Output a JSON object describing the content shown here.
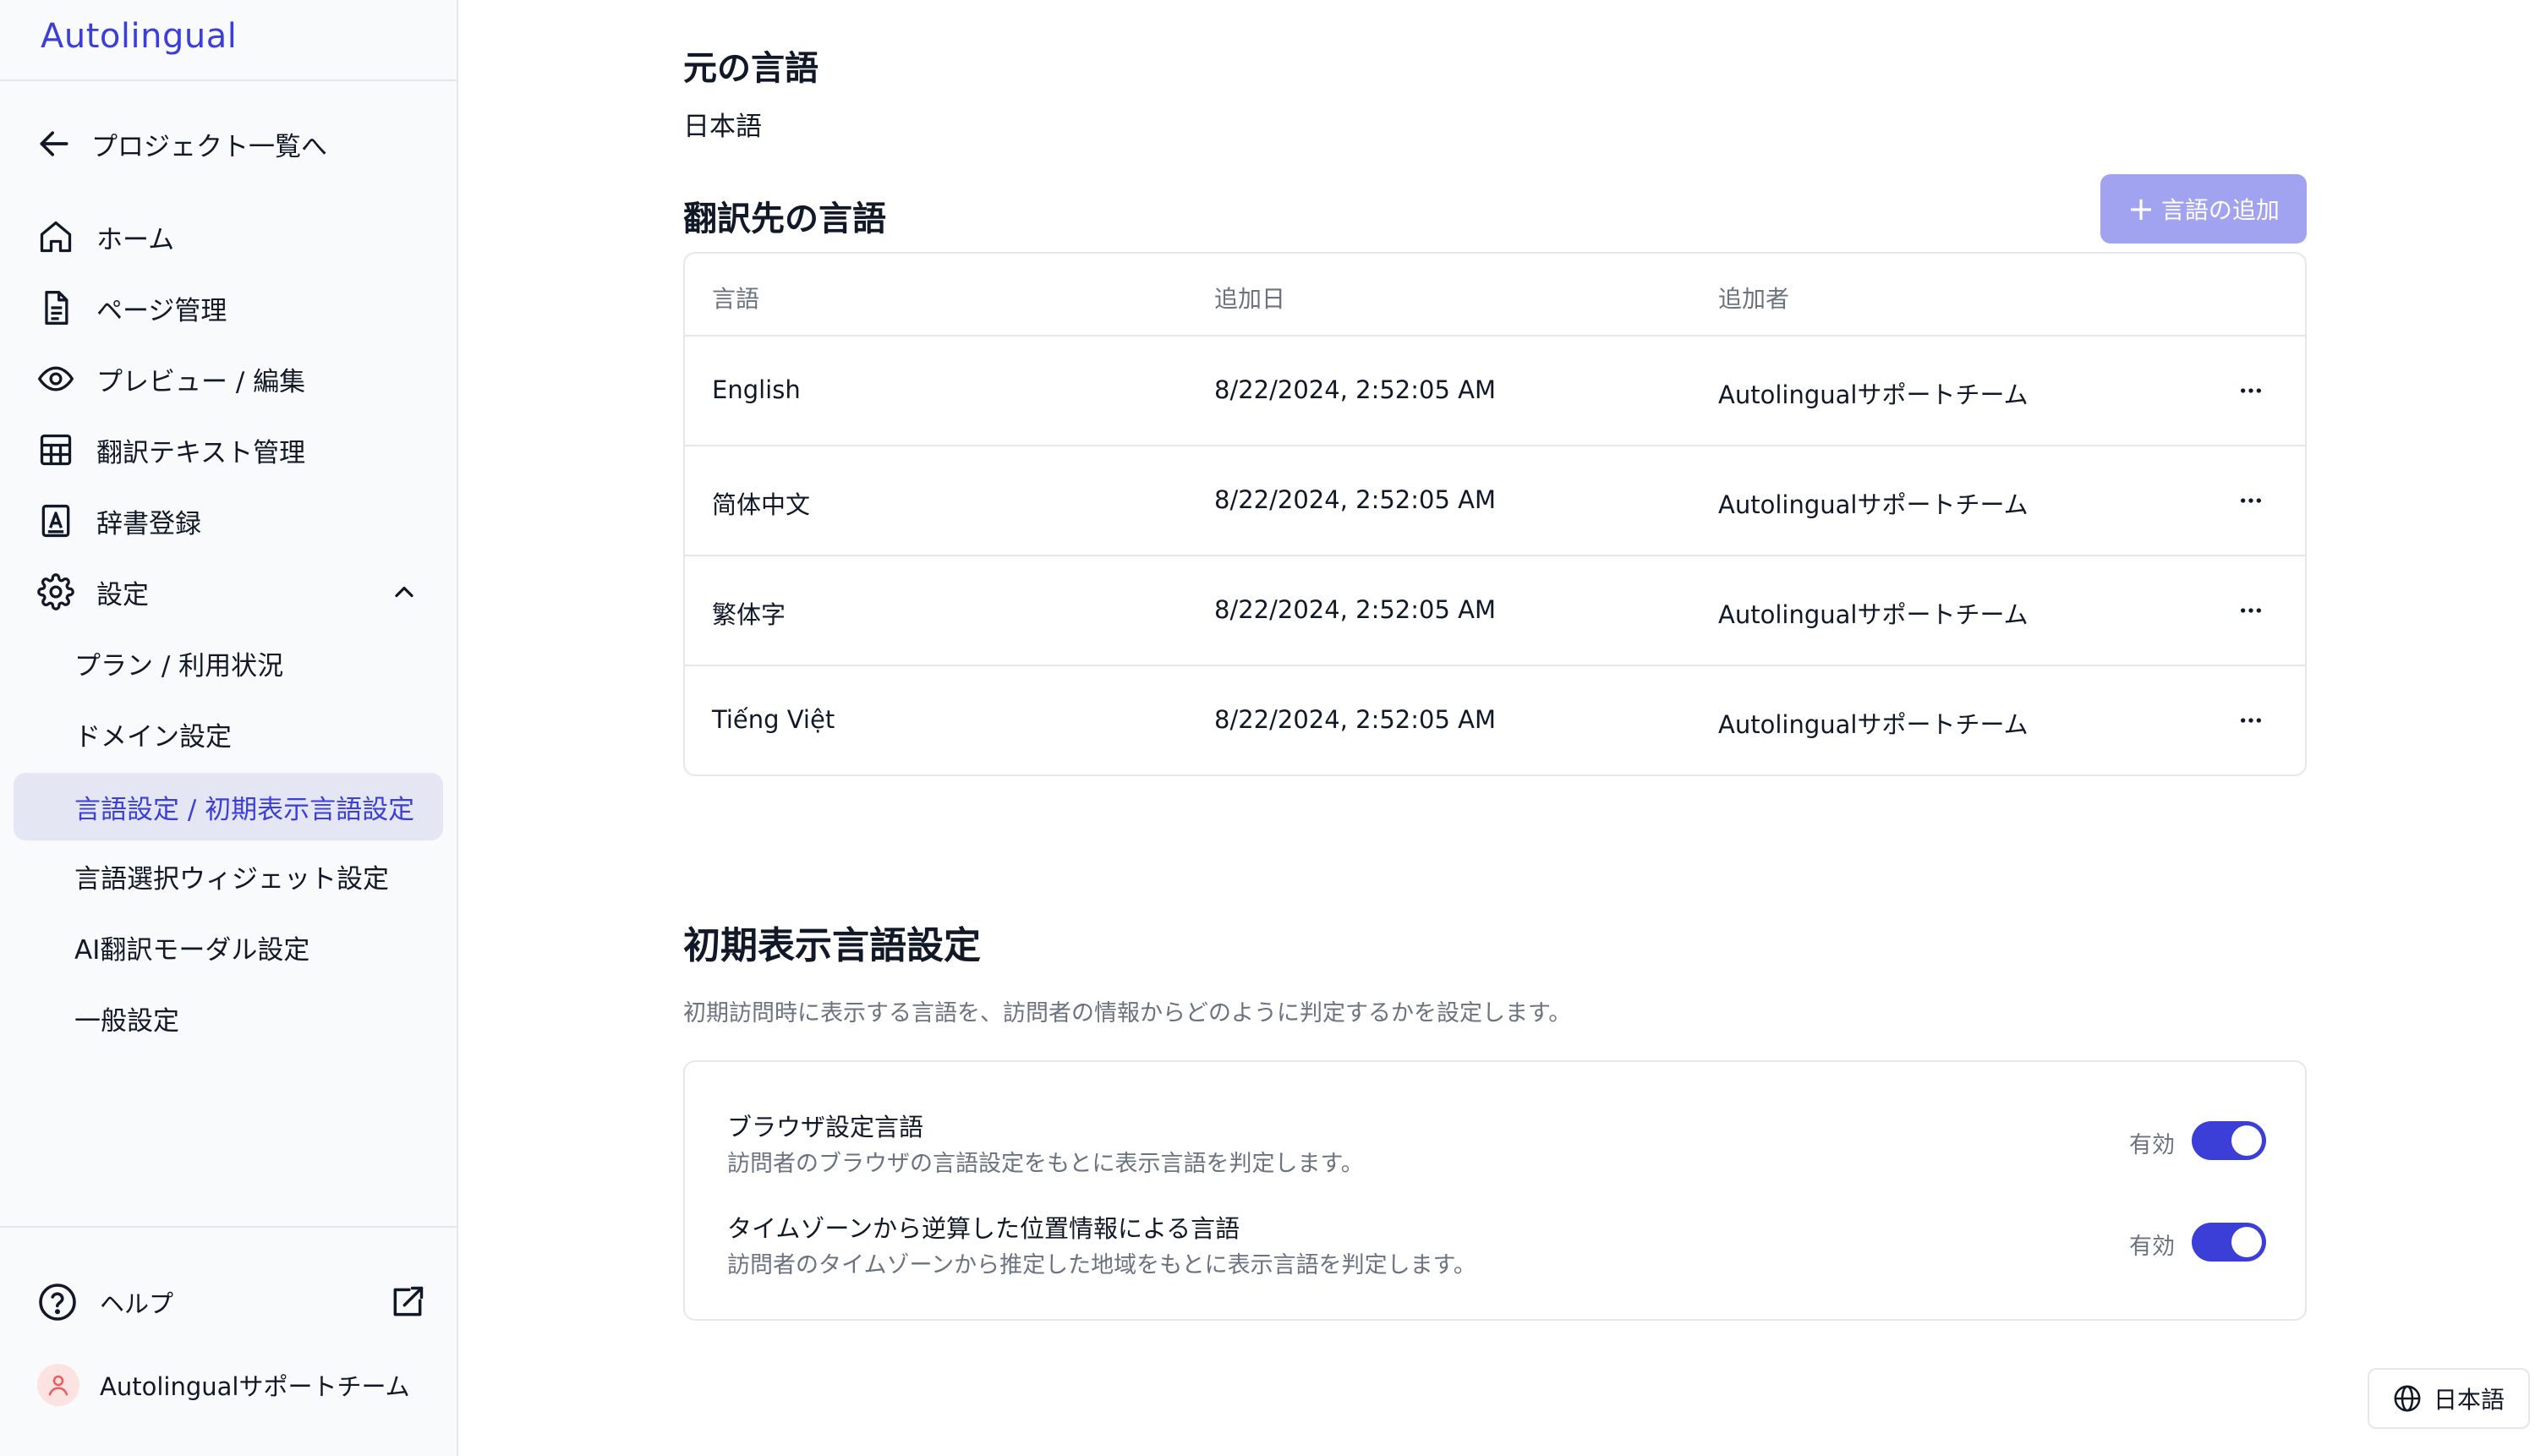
{
  "app": {
    "brand": "Autolingual"
  },
  "sidebar": {
    "back_label": "プロジェクト一覧へ",
    "items": [
      {
        "label": "ホーム",
        "icon": "home-icon"
      },
      {
        "label": "ページ管理",
        "icon": "document-icon"
      },
      {
        "label": "プレビュー / 編集",
        "icon": "eye-icon"
      },
      {
        "label": "翻訳テキスト管理",
        "icon": "table-icon"
      },
      {
        "label": "辞書登録",
        "icon": "dictionary-icon"
      },
      {
        "label": "設定",
        "icon": "gear-icon",
        "expanded": true
      }
    ],
    "sub_items": [
      {
        "label": "プラン / 利用状況"
      },
      {
        "label": "ドメイン設定"
      },
      {
        "label": "言語設定 / 初期表示言語設定",
        "active": true
      },
      {
        "label": "言語選択ウィジェット設定"
      },
      {
        "label": "AI翻訳モーダル設定"
      },
      {
        "label": "一般設定"
      }
    ],
    "help_label": "ヘルプ",
    "user_name": "Autolingualサポートチーム"
  },
  "source": {
    "heading": "元の言語",
    "value": "日本語"
  },
  "targets": {
    "heading": "翻訳先の言語",
    "add_button": "言語の追加",
    "columns": [
      "言語",
      "追加日",
      "追加者"
    ],
    "rows": [
      {
        "language": "English",
        "added_date": "8/22/2024, 2:52:05 AM",
        "added_by": "Autolingualサポートチーム"
      },
      {
        "language": "简体中文",
        "added_date": "8/22/2024, 2:52:05 AM",
        "added_by": "Autolingualサポートチーム"
      },
      {
        "language": "繁体字",
        "added_date": "8/22/2024, 2:52:05 AM",
        "added_by": "Autolingualサポートチーム"
      },
      {
        "language": "Tiếng Việt",
        "added_date": "8/22/2024, 2:52:05 AM",
        "added_by": "Autolingualサポートチーム"
      }
    ]
  },
  "initial_display": {
    "heading": "初期表示言語設定",
    "description": "初期訪問時に表示する言語を、訪問者の情報からどのように判定するかを設定します。",
    "options": [
      {
        "title": "ブラウザ設定言語",
        "description": "訪問者のブラウザの言語設定をもとに表示言語を判定します。",
        "toggle_label": "有効",
        "enabled": true
      },
      {
        "title": "タイムゾーンから逆算した位置情報による言語",
        "description": "訪問者のタイムゾーンから推定した地域をもとに表示言語を判定します。",
        "toggle_label": "有効",
        "enabled": true
      }
    ]
  },
  "language_switcher": {
    "label": "日本語",
    "icon": "globe-icon"
  },
  "colors": {
    "accent": "#3b3fd8",
    "button_disabled": "#a1a3f0",
    "active_bg": "#e5e6f3",
    "border": "#e5e7eb",
    "muted_text": "#6b7280"
  }
}
